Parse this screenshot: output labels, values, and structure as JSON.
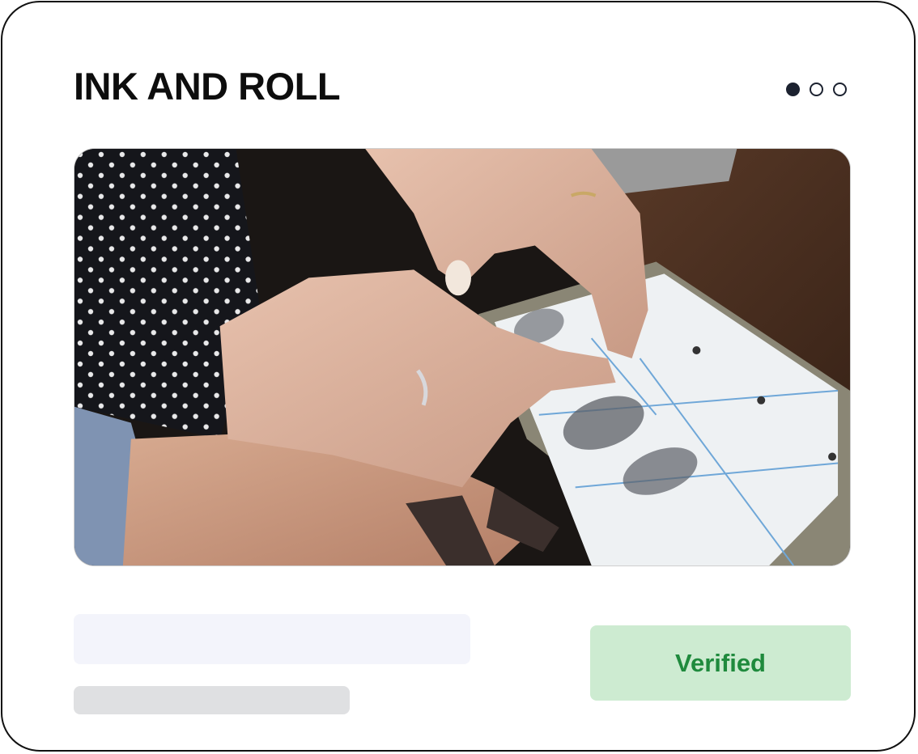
{
  "card": {
    "title": "INK AND ROLL",
    "pagination": {
      "total": 3,
      "active_index": 0
    },
    "photo": {
      "alt": "Hands rolling a fingertip onto a fingerprint card",
      "icon": "photo-image"
    },
    "status": {
      "label": "Verified",
      "text_color": "#1f8a3d",
      "background_color": "#cdebd1"
    }
  }
}
